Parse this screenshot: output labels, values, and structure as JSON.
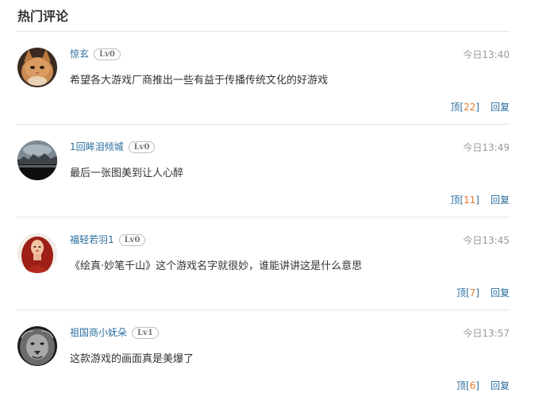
{
  "section_title": "热门评论",
  "comments": [
    {
      "username": "惊玄",
      "level": "Lv0",
      "time": "今日13:40",
      "content": "希望各大游戏厂商推出一些有益于传播传统文化的好游戏",
      "like_label": "顶",
      "like_count": "22",
      "reply_label": "回复",
      "avatar": "cat-avatar"
    },
    {
      "username": "1回眸泪倾城",
      "level": "Lv0",
      "time": "今日13:49",
      "content": "最后一张图美到让人心醉",
      "like_label": "顶",
      "like_count": "11",
      "reply_label": "回复",
      "avatar": "landscape-avatar"
    },
    {
      "username": "福轻若羽1",
      "level": "Lv0",
      "time": "今日13:45",
      "content": "《绘真·妙笔千山》这个游戏名字就很妙，谁能讲讲这是什么意思",
      "like_label": "顶",
      "like_count": "7",
      "reply_label": "回复",
      "avatar": "redhair-avatar"
    },
    {
      "username": "祖国商小妩朵",
      "level": "Lv1",
      "time": "今日13:57",
      "content": "这款游戏的画面真是美爆了",
      "like_label": "顶",
      "like_count": "6",
      "reply_label": "回复",
      "avatar": "lion-avatar"
    }
  ],
  "colors": {
    "link": "#2a6d9e",
    "count": "#e07a2f",
    "time": "#999999",
    "text": "#333333"
  }
}
